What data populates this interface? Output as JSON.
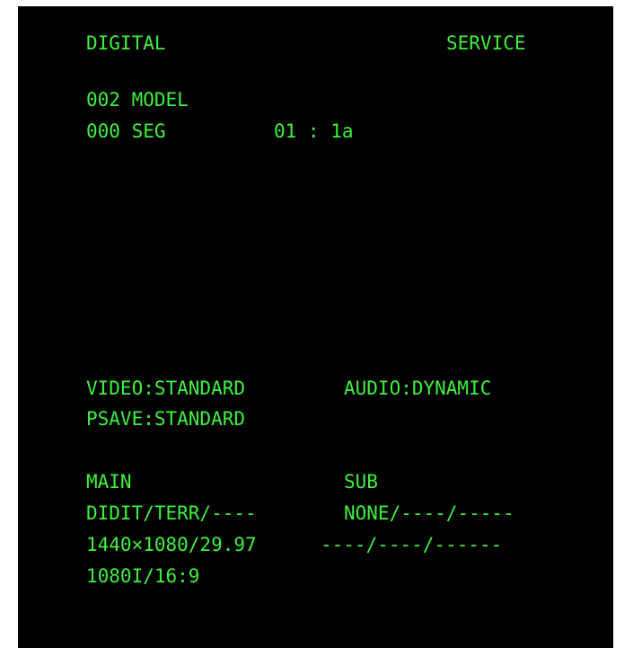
{
  "header": {
    "left": "DIGITAL",
    "right": "SERVICE"
  },
  "info": {
    "model": "002 MODEL",
    "seg_label": "000 SEG",
    "seg_value": "01 : 1a"
  },
  "settings": {
    "video": "VIDEO:STANDARD",
    "audio": "AUDIO:DYNAMIC",
    "psave": "PSAVE:STANDARD"
  },
  "main": {
    "title": "MAIN",
    "source": "DIDIT/TERR/----",
    "resolution": "1440×1080/29.97",
    "format": "1080I/16:9"
  },
  "sub": {
    "title": "SUB",
    "source": "NONE/----/-----",
    "resolution": "----/----/------"
  },
  "colors": {
    "text": "#3df03d",
    "background": "#000000"
  }
}
